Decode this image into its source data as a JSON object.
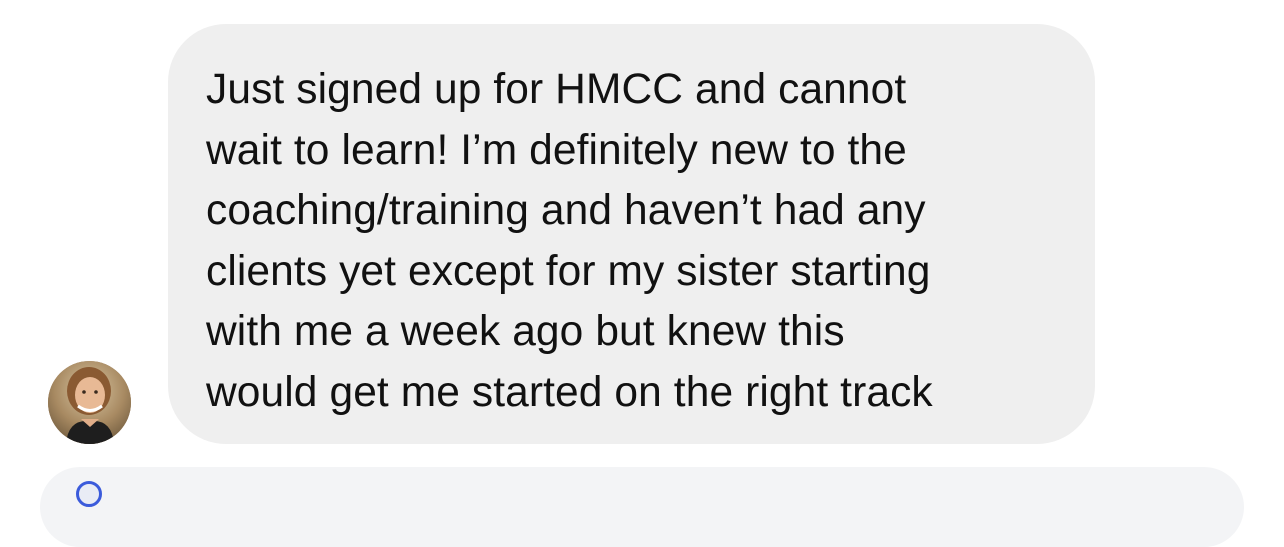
{
  "message": {
    "sender_avatar": "profile-photo",
    "lines": [
      "Just signed up for HMCC and cannot",
      "wait to learn! I’m definitely new to the",
      "coaching/training and haven’t had any",
      "clients yet except for my sister starting",
      "with me a week ago but knew this",
      "would get me started on the right track"
    ]
  },
  "colors": {
    "bubble_background": "#efefef",
    "text": "#111111",
    "next_bubble_background": "#f3f4f6",
    "next_avatar_ring": "#3b5bdb"
  }
}
